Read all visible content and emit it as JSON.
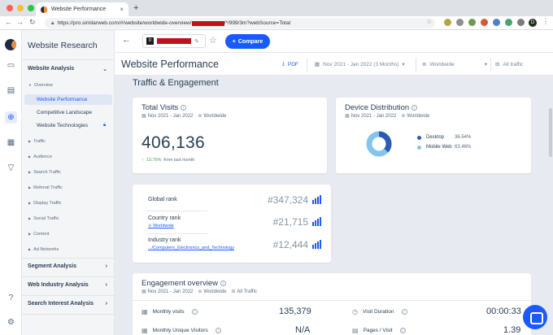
{
  "browser": {
    "tab_title": "Website Performance",
    "tab_close": "×",
    "new_tab": "+",
    "url_prefix": "https://pro.similarweb.com/#/website/worldwide-overview/",
    "url_suffix": "/*/999/3m?webSource=Total",
    "profile_initial": "D"
  },
  "rail": {
    "icons": [
      "similarweb-logo-icon",
      "home-icon",
      "research-icon",
      "globe-icon",
      "apps-icon",
      "funnel-icon",
      "help-icon",
      "settings-icon"
    ]
  },
  "sidenav": {
    "brand": "Website Research",
    "section_website_analysis": "Website Analysis",
    "overview": "Overview",
    "items": {
      "website_performance": "Website Performance",
      "competitive_landscape": "Competitive Landscape",
      "website_technologies": "Website Technologies"
    },
    "subsections": {
      "traffic": "Traffic",
      "audience": "Audience",
      "search_traffic": "Search Traffic",
      "referral_traffic": "Referral Traffic",
      "display_traffic": "Display Traffic",
      "social_traffic": "Social Traffic",
      "content": "Content",
      "ad_networks": "Ad Networks"
    },
    "sections": {
      "segment_analysis": "Segment Analysis",
      "web_industry_analysis": "Web Industry Analysis",
      "search_interest_analysis": "Search Interest Analysis"
    }
  },
  "topbar": {
    "compare_label": "Compare",
    "compare_plus": "+",
    "site_favicon_letter": "D"
  },
  "page": {
    "title": "Website Performance",
    "pdf_label": "PDF",
    "date_range": "Nov 2021 - Jan 2022 (3 Months)",
    "region": "Worldwide",
    "traffic": "All traffic"
  },
  "section_title": "Traffic & Engagement",
  "total_visits": {
    "title": "Total Visits",
    "date": "Nov 2021 - Jan 2022",
    "region": "Worldwide",
    "value": "406,136",
    "change_pct": "13.76%",
    "change_label": "from last month"
  },
  "device": {
    "title": "Device Distribution",
    "date": "Nov 2021 - Jan 2022",
    "region": "Worldwide",
    "desktop_label": "Desktop",
    "desktop_pct": "36.54%",
    "mobile_label": "Mobile Web",
    "mobile_pct": "63.46%",
    "desktop_share": 36.54,
    "mobile_share": 63.46,
    "desktop_color": "#2b5cb3",
    "mobile_color": "#84c5ec"
  },
  "ranks": {
    "global_label": "Global rank",
    "global_value": "#347,324",
    "country_label": "Country rank",
    "country_link": "Worldwide",
    "country_value": "#21,715",
    "industry_label": "Industry rank",
    "industry_link": ".../Computers_Electronics_and_Technology",
    "industry_value": "#12,444"
  },
  "engagement": {
    "title": "Engagement overview",
    "date": "Nov 2021 - Jan 2022",
    "region": "Worldwide",
    "traffic": "All Traffic",
    "monthly_visits_label": "Monthly visits",
    "monthly_visits_value": "135,379",
    "visit_duration_label": "Visit Duration",
    "visit_duration_value": "00:00:33",
    "unique_visitors_label": "Monthly Unique Visitors",
    "unique_visitors_value": "N/A",
    "pages_visit_label": "Pages / Visit",
    "pages_visit_value": "1.39"
  },
  "colors": {
    "accent": "#195afe",
    "redacted": "#c0121a",
    "positive": "#3fa55d"
  }
}
